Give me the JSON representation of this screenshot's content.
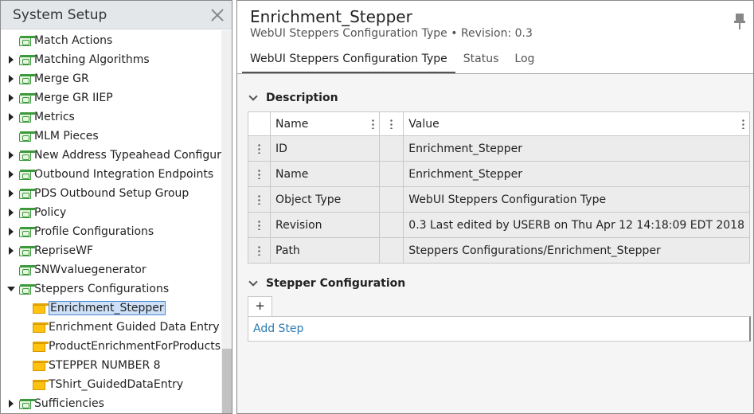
{
  "left_panel": {
    "title": "System Setup",
    "tree": [
      {
        "label": "Match Actions",
        "icon": "green-folder-icon",
        "caret": "none",
        "indent": 0
      },
      {
        "label": "Matching Algorithms",
        "icon": "green-folder-icon",
        "caret": "right",
        "indent": 0
      },
      {
        "label": "Merge GR",
        "icon": "green-folder-icon",
        "caret": "right",
        "indent": 0
      },
      {
        "label": "Merge GR IIEP",
        "icon": "green-folder-icon",
        "caret": "right",
        "indent": 0
      },
      {
        "label": "Metrics",
        "icon": "green-folder-icon",
        "caret": "right",
        "indent": 0
      },
      {
        "label": "MLM Pieces",
        "icon": "green-folder-icon",
        "caret": "none",
        "indent": 0
      },
      {
        "label": "New Address Typeahead Configuration",
        "icon": "green-folder-icon",
        "caret": "right",
        "indent": 0
      },
      {
        "label": "Outbound Integration Endpoints",
        "icon": "green-folder-icon",
        "caret": "right",
        "indent": 0
      },
      {
        "label": "PDS Outbound Setup Group",
        "icon": "green-folder-icon",
        "caret": "right",
        "indent": 0
      },
      {
        "label": "Policy",
        "icon": "green-folder-icon",
        "caret": "right",
        "indent": 0
      },
      {
        "label": "Profile Configurations",
        "icon": "green-folder-icon",
        "caret": "right",
        "indent": 0
      },
      {
        "label": "RepriseWF",
        "icon": "green-folder-icon",
        "caret": "right",
        "indent": 0
      },
      {
        "label": "SNWvaluegenerator",
        "icon": "green-folder-icon",
        "caret": "none",
        "indent": 0
      },
      {
        "label": "Steppers Configurations",
        "icon": "green-folder-icon",
        "caret": "down",
        "indent": 0
      },
      {
        "label": "Enrichment_Stepper",
        "icon": "yellow-folder-icon",
        "caret": "none",
        "indent": 1,
        "selected": true
      },
      {
        "label": "Enrichment Guided Data Entry",
        "icon": "yellow-folder-icon",
        "caret": "none",
        "indent": 1
      },
      {
        "label": "ProductEnrichmentForProducts",
        "icon": "yellow-folder-icon",
        "caret": "none",
        "indent": 1
      },
      {
        "label": "STEPPER NUMBER 8",
        "icon": "yellow-folder-icon",
        "caret": "none",
        "indent": 1
      },
      {
        "label": "TShirt_GuidedDataEntry",
        "icon": "yellow-folder-icon",
        "caret": "none",
        "indent": 1
      },
      {
        "label": "Sufficiencies",
        "icon": "green-folder-icon",
        "caret": "right",
        "indent": 0
      }
    ]
  },
  "right_panel": {
    "title": "Enrichment_Stepper",
    "subtitle_type": "WebUI Steppers Configuration Type",
    "subtitle_sep": "•",
    "subtitle_revision": "Revision: 0.3",
    "tabs": [
      {
        "label": "WebUI Steppers Configuration Type",
        "active": true
      },
      {
        "label": "Status",
        "active": false
      },
      {
        "label": "Log",
        "active": false
      }
    ],
    "description": {
      "heading": "Description",
      "col_name": "Name",
      "col_value": "Value",
      "rows": [
        {
          "name": "ID",
          "value": "Enrichment_Stepper"
        },
        {
          "name": "Name",
          "value": "Enrichment_Stepper"
        },
        {
          "name": "Object Type",
          "value": "WebUI Steppers Configuration Type"
        },
        {
          "name": "Revision",
          "value": "0.3 Last edited by USERB on Thu Apr 12 14:18:09 EDT 2018"
        },
        {
          "name": "Path",
          "value": "Steppers Configurations/Enrichment_Stepper"
        }
      ]
    },
    "stepper": {
      "heading": "Stepper Configuration",
      "add_label": "+",
      "add_step_label": "Add Step"
    }
  }
}
